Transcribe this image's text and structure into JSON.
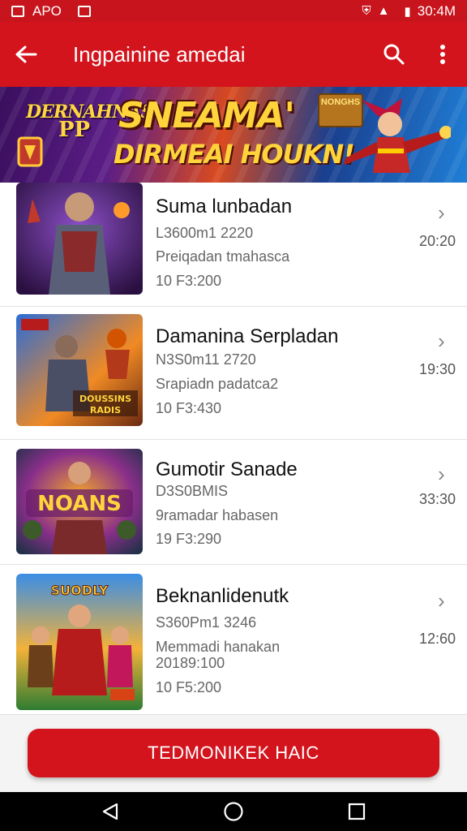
{
  "status_bar": {
    "left_text": "APO",
    "time": "30:4M"
  },
  "app_bar": {
    "title": "Ingpainine amedai",
    "back_icon": "arrow-left-icon",
    "search_icon": "search-icon",
    "menu_icon": "more-vert-icon"
  },
  "banner": {
    "logo_top": "DERNAHNAS",
    "logo_sub": "PP",
    "headline": "SNEAMA'",
    "subline": "DIRMEAI HOUKN!",
    "badge": "NONGHS"
  },
  "items": [
    {
      "name": "Suma lunbadan",
      "line1": "L3600m1 2220",
      "line2": "Preiqadan tmahasca",
      "line3": "10 F3:200",
      "meta": "20:20"
    },
    {
      "name": "Damanina Serpladan",
      "line1": "N3S0m11 2720",
      "line2": "Srapiadn padatca2",
      "line3": "10 F3:430",
      "meta": "19:30",
      "thumb_label": "DOUSSINS RADIS"
    },
    {
      "name": "Gumotir Sanade",
      "line1": "D3S0BMIS",
      "line2": "9ramadar habasen",
      "line3": "19 F3:290",
      "meta": "33:30",
      "thumb_label": "NOANS"
    },
    {
      "name": "Beknanlidenutk",
      "line1": "S360Pm1 3246",
      "line2": "Memmadi hanakan",
      "line3": "20189:100",
      "line4": "10 F5:200",
      "meta": "12:60",
      "thumb_label": "SUODLY"
    }
  ],
  "cta": {
    "label": "TEDMONIKEK HAIC"
  },
  "colors": {
    "primary": "#d3141d",
    "status": "#c8141c"
  }
}
